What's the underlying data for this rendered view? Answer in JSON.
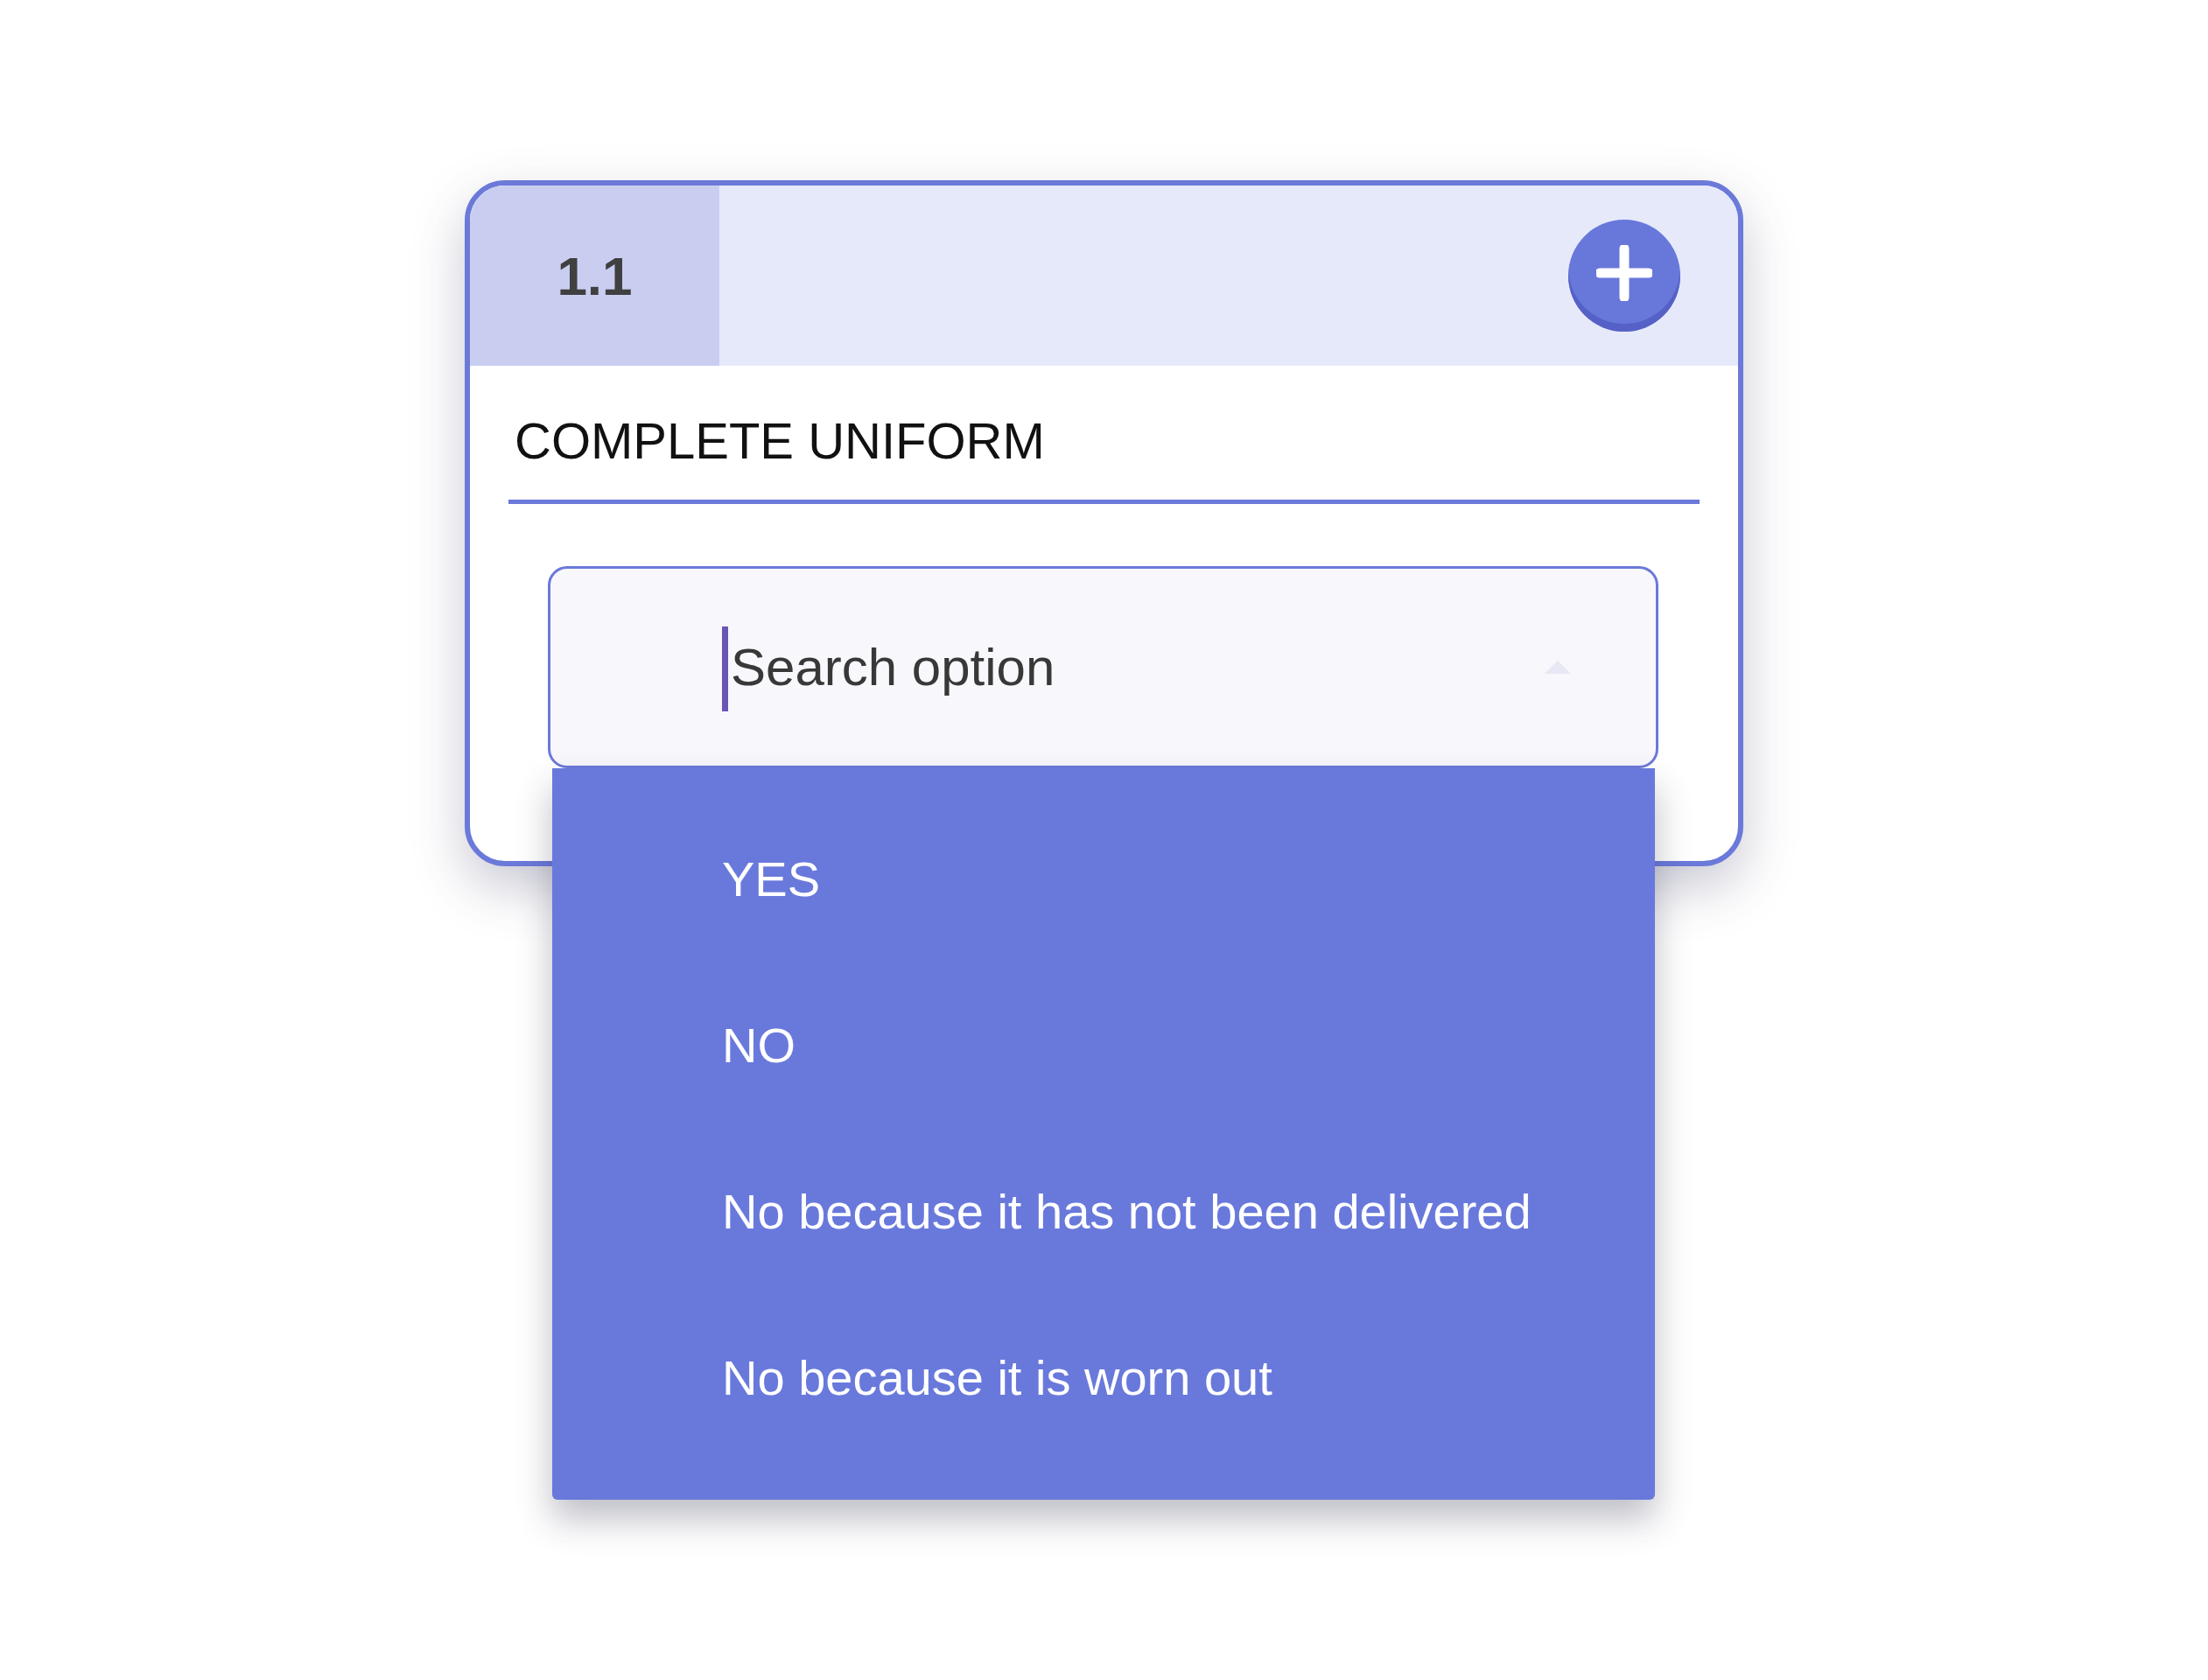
{
  "question": {
    "number": "1.1",
    "title": "COMPLETE UNIFORM"
  },
  "search": {
    "placeholder": "Search option",
    "focused": true,
    "expanded": true,
    "options": [
      "YES",
      "NO",
      "No because it has not been delivered",
      "No because it is worn out"
    ]
  }
}
